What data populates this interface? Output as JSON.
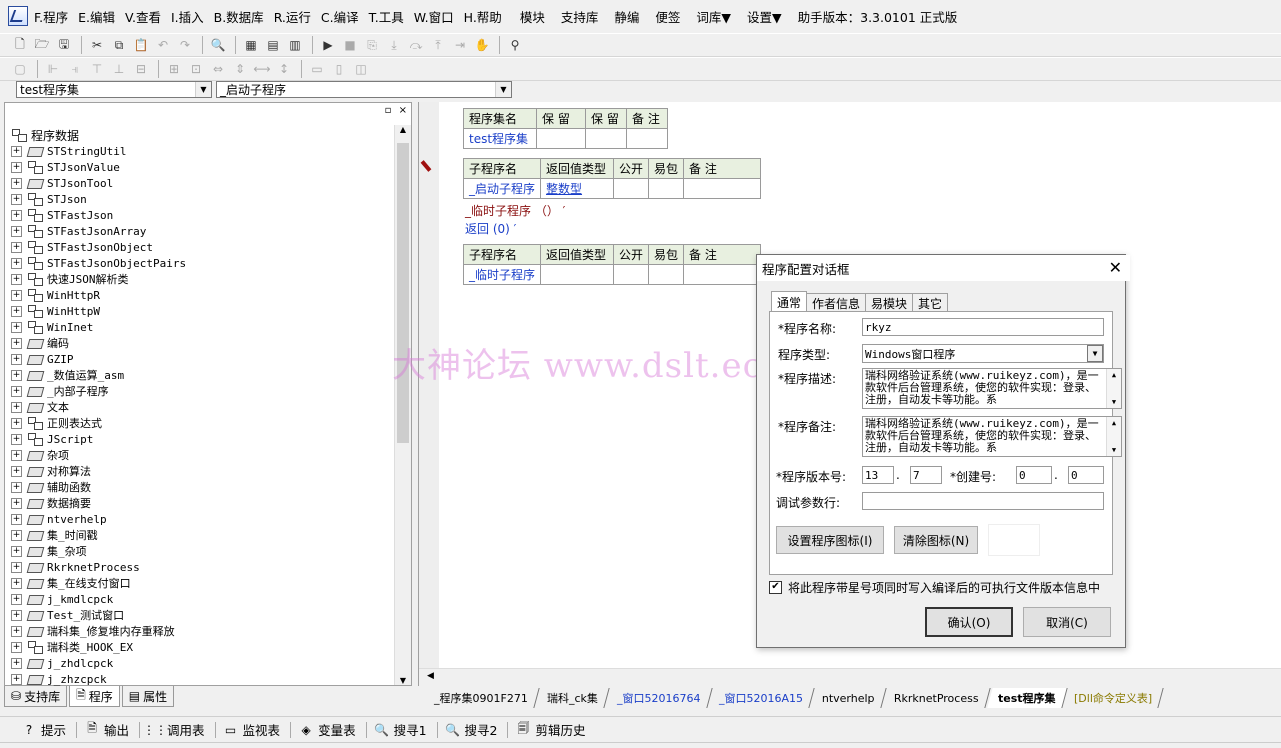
{
  "menu": {
    "items": [
      "F.程序",
      "E.编辑",
      "V.查看",
      "I.插入",
      "B.数据库",
      "R.运行",
      "C.编译",
      "T.工具",
      "W.窗口",
      "H.帮助"
    ],
    "extra": [
      "模块",
      "支持库",
      "静编",
      "便签",
      "词库▼",
      "设置▼"
    ],
    "version": "助手版本：3.3.0101 正式版"
  },
  "combos": {
    "assembly": "test程序集",
    "subroutine": "_启动子程序"
  },
  "left_panel": {
    "pin": "▫",
    "close": "×",
    "root": "程序数据",
    "items": [
      {
        "label": "STStringUtil",
        "icon": "lib"
      },
      {
        "label": "STJsonValue",
        "icon": "cls"
      },
      {
        "label": "STJsonTool",
        "icon": "lib"
      },
      {
        "label": "STJson",
        "icon": "cls"
      },
      {
        "label": "STFastJson",
        "icon": "cls"
      },
      {
        "label": "STFastJsonArray",
        "icon": "cls"
      },
      {
        "label": "STFastJsonObject",
        "icon": "cls"
      },
      {
        "label": "STFastJsonObjectPairs",
        "icon": "cls"
      },
      {
        "label": "快速JSON解析类",
        "icon": "cls"
      },
      {
        "label": "WinHttpR",
        "icon": "cls"
      },
      {
        "label": "WinHttpW",
        "icon": "cls"
      },
      {
        "label": "WinInet",
        "icon": "cls"
      },
      {
        "label": "编码",
        "icon": "lib"
      },
      {
        "label": "GZIP",
        "icon": "lib"
      },
      {
        "label": "_数值运算_asm",
        "icon": "lib"
      },
      {
        "label": "_内部子程序",
        "icon": "lib"
      },
      {
        "label": "文本",
        "icon": "lib"
      },
      {
        "label": "正则表达式",
        "icon": "cls"
      },
      {
        "label": "JScript",
        "icon": "cls"
      },
      {
        "label": "杂项",
        "icon": "lib"
      },
      {
        "label": "对称算法",
        "icon": "lib"
      },
      {
        "label": "辅助函数",
        "icon": "lib"
      },
      {
        "label": "数据摘要",
        "icon": "lib"
      },
      {
        "label": "ntverhelp",
        "icon": "lib"
      },
      {
        "label": "集_时间戳",
        "icon": "lib"
      },
      {
        "label": "集_杂项",
        "icon": "lib"
      },
      {
        "label": "RkrknetProcess",
        "icon": "lib"
      },
      {
        "label": "集_在线支付窗口",
        "icon": "lib"
      },
      {
        "label": "j_kmdlcpck",
        "icon": "lib"
      },
      {
        "label": "Test_测试窗口",
        "icon": "lib"
      },
      {
        "label": "瑞科集_修复堆内存重释放",
        "icon": "lib"
      },
      {
        "label": "瑞科类_HOOK_EX",
        "icon": "cls"
      },
      {
        "label": "j_zhdlcpck",
        "icon": "lib"
      },
      {
        "label": "j_zhzcpck",
        "icon": "lib"
      }
    ],
    "tabs": [
      "支持库",
      "程序",
      "属性"
    ]
  },
  "editor": {
    "assembly_table": {
      "headers": [
        "程序集名",
        "保 留",
        "保 留",
        "备 注"
      ],
      "row": [
        "test程序集",
        "",
        "",
        ""
      ]
    },
    "sub1_table": {
      "headers": [
        "子程序名",
        "返回值类型",
        "公开",
        "易包",
        "备 注"
      ],
      "row": [
        "_启动子程序",
        "整数型",
        "",
        "",
        ""
      ]
    },
    "code_lines": [
      "_临时子程序 （） ′",
      "返回 (0) ′"
    ],
    "sub2_table": {
      "headers": [
        "子程序名",
        "返回值类型",
        "公开",
        "易包",
        "备 注"
      ],
      "row": [
        "_临时子程序",
        "",
        "",
        "",
        ""
      ]
    },
    "tabs": [
      "_程序集0901F271",
      "瑞科_ck集",
      "_窗口52016764",
      "_窗口52016A15",
      "ntverhelp",
      "RkrknetProcess",
      "test程序集",
      "[Dll命令定义表]"
    ],
    "active_tab": "test程序集"
  },
  "watermark": "大神论坛  www.dslt.ecd",
  "bottom_tabs": [
    "提示",
    "输出",
    "调用表",
    "监视表",
    "变量表",
    "搜寻1",
    "搜寻2",
    "剪辑历史"
  ],
  "dialog": {
    "title": "程序配置对话框",
    "close": "✕",
    "tabs": [
      "通常",
      "作者信息",
      "易模块",
      "其它"
    ],
    "name_label": "*程序名称:",
    "name_value": "rkyz",
    "type_label": "程序类型:",
    "type_value": "Windows窗口程序",
    "desc_label": "*程序描述:",
    "desc_value": "瑞科网络验证系统(www.ruikeyz.com)，是一款软件后台管理系统，使您的软件实现：登录、注册，自动发卡等功能。系",
    "note_label": "*程序备注:",
    "note_value": "瑞科网络验证系统(www.ruikeyz.com)，是一款软件后台管理系统，使您的软件实现：登录、注册，自动发卡等功能。系",
    "version_label": "*程序版本号:",
    "version_major": "13",
    "version_minor": "7",
    "build_label": "*创建号:",
    "build_major": "0",
    "build_minor": "0",
    "debug_label": "调试参数行:",
    "debug_value": "",
    "set_icon": "设置程序图标(I)",
    "clear_icon": "清除图标(N)",
    "checkbox_label": "将此程序带星号项同时写入编译后的可执行文件版本信息中",
    "checkbox_checked": true,
    "ok": "确认(O)",
    "cancel": "取消(C)"
  }
}
